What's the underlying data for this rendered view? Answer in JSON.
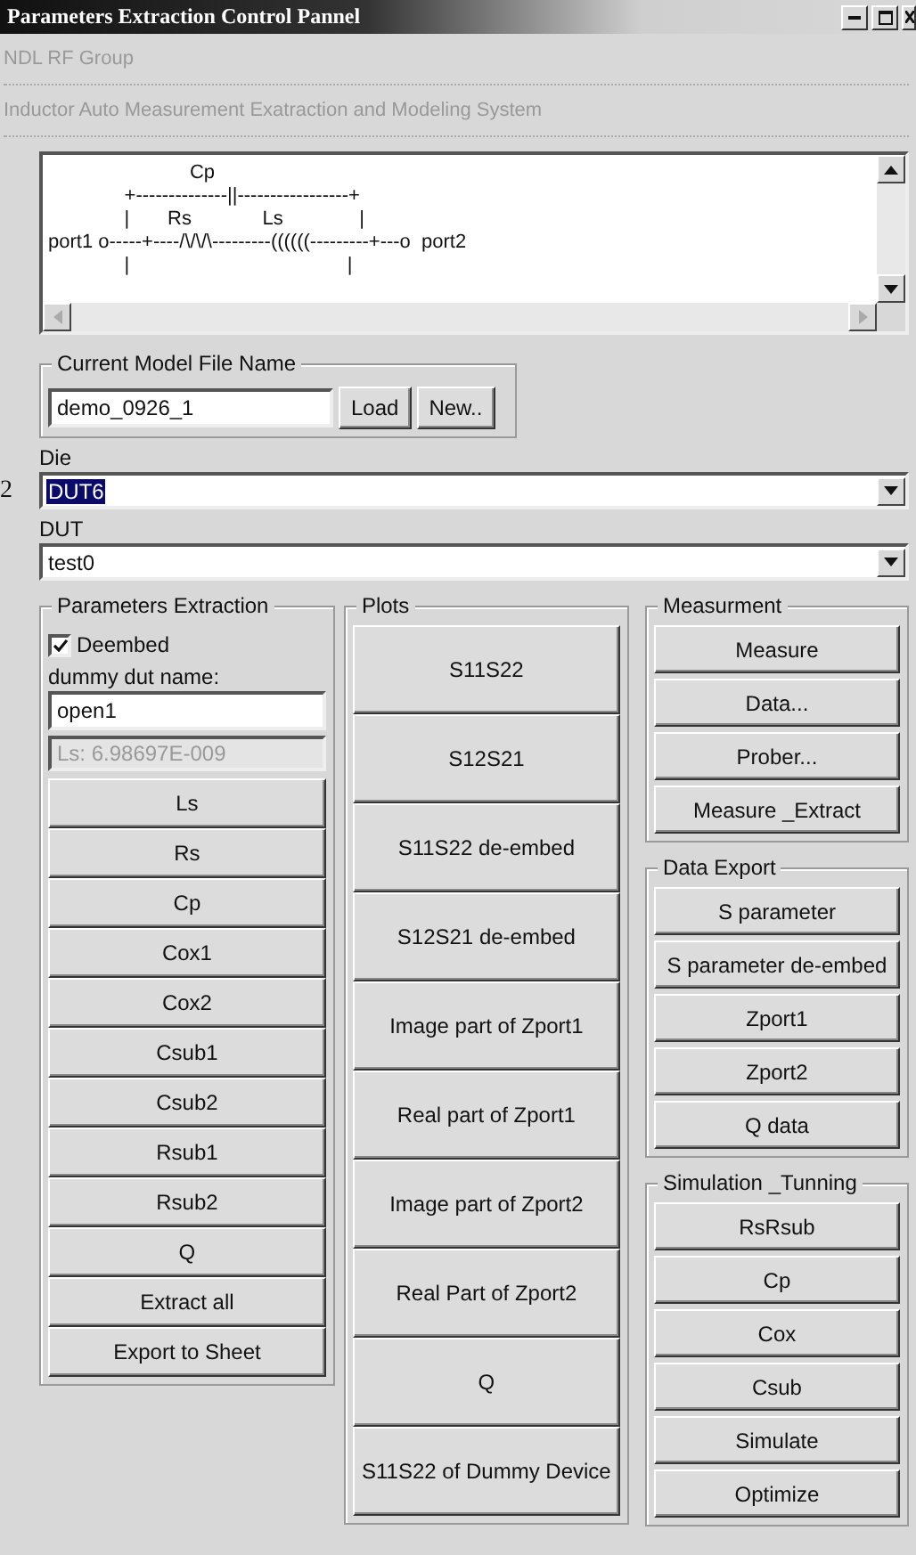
{
  "page_mark": "2",
  "window": {
    "title": "Parameters Extraction Control Pannel"
  },
  "header_lines": [
    "NDL RF Group",
    "Inductor Auto Measurement Exatraction and Modeling System"
  ],
  "circuit_lines": [
    "                          Cp",
    "              +--------------||-----------------+",
    "              |       Rs             Ls              |",
    "port1 o-----+----/\\/\\/\\---------((((((---------+---o  port2",
    "              |                                        |"
  ],
  "model_file": {
    "title": "Current Model File Name",
    "value": "demo_0926_1",
    "buttons": [
      "Load",
      "New.."
    ]
  },
  "combos": [
    {
      "label": "Die",
      "value": "DUT6",
      "highlighted": true
    },
    {
      "label": "DUT",
      "value": "test0",
      "highlighted": false
    }
  ],
  "extraction": {
    "title": "Parameters Extraction",
    "deembed": {
      "label": "Deembed",
      "checked": true
    },
    "dummy_label": "dummy dut name:",
    "dummy_value": "open1",
    "result": "Ls: 6.98697E-009",
    "buttons": [
      "Ls",
      "Rs",
      "Cp",
      "Cox1",
      "Cox2",
      "Csub1",
      "Csub2",
      "Rsub1",
      "Rsub2",
      "Q",
      "Extract all",
      "Export to Sheet"
    ]
  },
  "plots": {
    "title": "Plots",
    "buttons": [
      "S11S22",
      "S12S21",
      "S11S22 de-embed",
      "S12S21 de-embed",
      "Image part of Zport1",
      "Real part of Zport1",
      "Image part of Zport2",
      "Real Part of Zport2",
      "Q",
      "S11S22 of Dummy Device"
    ]
  },
  "right_groups": [
    {
      "title": "Measurment",
      "buttons": [
        "Measure",
        "Data...",
        "Prober...",
        "Measure _Extract"
      ]
    },
    {
      "title": "Data Export",
      "buttons": [
        "S parameter",
        "S parameter de-embed",
        "Zport1",
        "Zport2",
        "Q data"
      ]
    },
    {
      "title": "Simulation _Tunning",
      "buttons": [
        "RsRsub",
        "Cp",
        "Cox",
        "Csub",
        "Simulate",
        "Optimize"
      ]
    }
  ]
}
